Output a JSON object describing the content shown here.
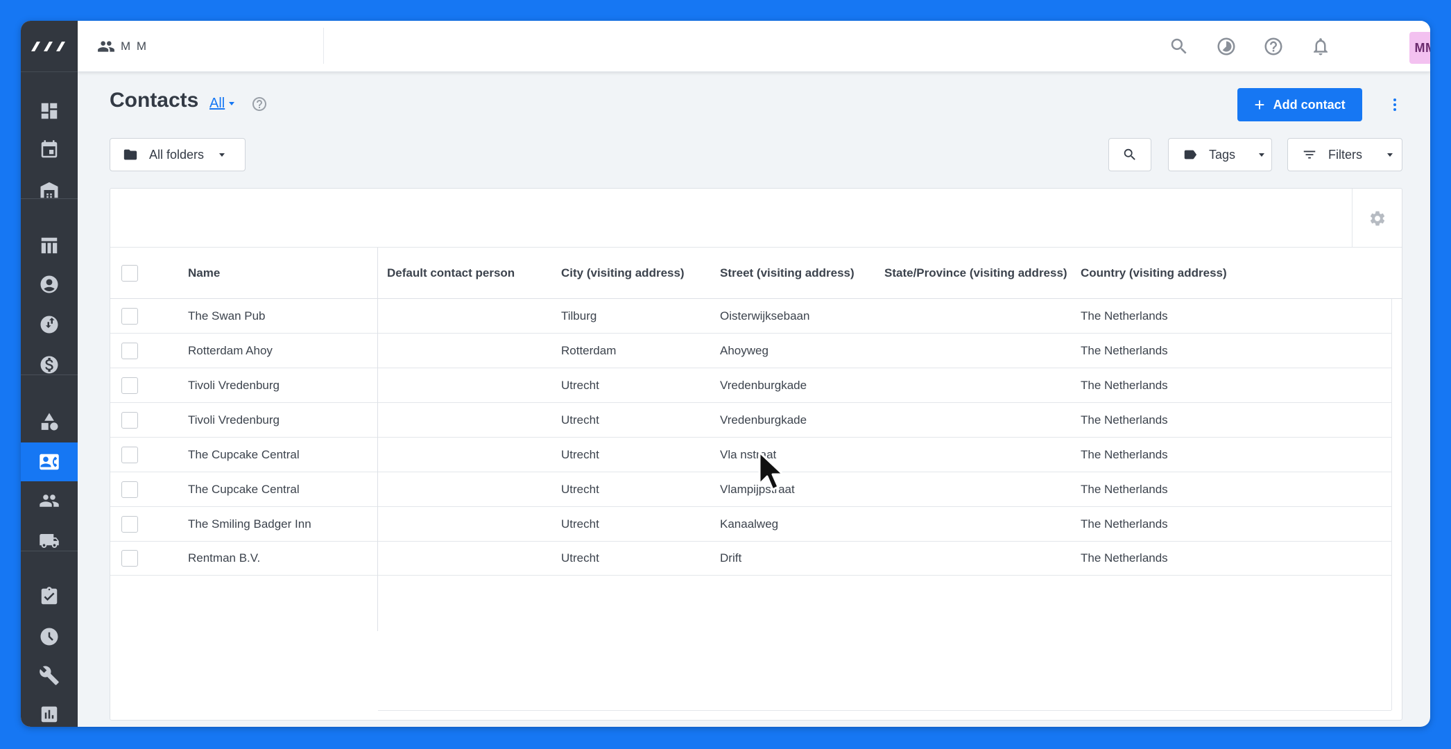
{
  "account_name": "M M",
  "user": {
    "initials": "MM",
    "name": "M M"
  },
  "page": {
    "title": "Contacts",
    "filter_label": "All",
    "add_button_label": "Add contact"
  },
  "toolbar": {
    "folders_label": "All folders",
    "tags_label": "Tags",
    "filters_label": "Filters"
  },
  "table": {
    "columns": [
      "Name",
      "Default contact person",
      "City (visiting address)",
      "Street (visiting address)",
      "State/Province (visiting address)",
      "Country (visiting address)"
    ],
    "rows": [
      {
        "name": "The Swan Pub",
        "contact_person": "",
        "city": "Tilburg",
        "street": "Oisterwijksebaan",
        "state": "",
        "country": "The Netherlands"
      },
      {
        "name": "Rotterdam Ahoy",
        "contact_person": "",
        "city": "Rotterdam",
        "street": "Ahoyweg",
        "state": "",
        "country": "The Netherlands"
      },
      {
        "name": "Tivoli Vredenburg",
        "contact_person": "",
        "city": "Utrecht",
        "street": "Vredenburgkade",
        "state": "",
        "country": "The Netherlands"
      },
      {
        "name": "Tivoli Vredenburg",
        "contact_person": "",
        "city": "Utrecht",
        "street": "Vredenburgkade",
        "state": "",
        "country": "The Netherlands"
      },
      {
        "name": "The Cupcake Central",
        "contact_person": "",
        "city": "Utrecht",
        "street": "Vla    nstraat",
        "state": "",
        "country": "The Netherlands"
      },
      {
        "name": "The Cupcake Central",
        "contact_person": "",
        "city": "Utrecht",
        "street": "Vlampijpstraat",
        "state": "",
        "country": "The Netherlands"
      },
      {
        "name": "The Smiling Badger Inn",
        "contact_person": "",
        "city": "Utrecht",
        "street": "Kanaalweg",
        "state": "",
        "country": "The Netherlands"
      },
      {
        "name": "Rentman B.V.",
        "contact_person": "",
        "city": "Utrecht",
        "street": "Drift",
        "state": "",
        "country": "The Netherlands"
      }
    ]
  },
  "sidebar": {
    "items": [
      {
        "icon": "dashboard-icon"
      },
      {
        "icon": "calendar-icon"
      },
      {
        "icon": "warehouse-icon"
      },
      {
        "icon": "table-icon"
      },
      {
        "icon": "account-circle-icon"
      },
      {
        "icon": "swap-icon"
      },
      {
        "icon": "dollar-icon"
      },
      {
        "icon": "shapes-icon"
      },
      {
        "icon": "contact-card-icon",
        "active": true
      },
      {
        "icon": "people-icon"
      },
      {
        "icon": "truck-icon"
      },
      {
        "icon": "clipboard-check-icon"
      },
      {
        "icon": "clock-icon"
      },
      {
        "icon": "wrench-icon"
      },
      {
        "icon": "report-icon"
      }
    ]
  },
  "colors": {
    "accent": "#1677f3",
    "sidebar": "#32373f",
    "avatar_bg": "#f3c1f0"
  }
}
